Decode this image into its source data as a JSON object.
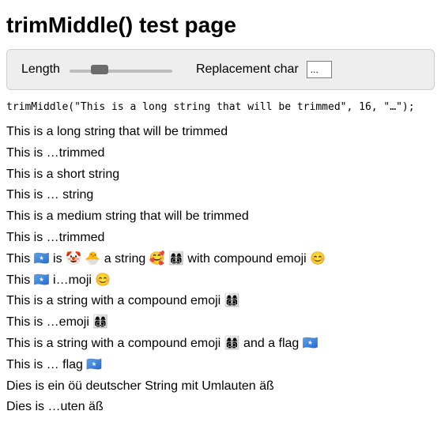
{
  "title": "trimMiddle() test page",
  "controls": {
    "length_label": "Length",
    "length_value": "16",
    "replacement_label": "Replacement char",
    "replacement_value": "..."
  },
  "code_sample": "trimMiddle(\"This is a long string that will be trimmed\", 16, \"…\");",
  "lines": [
    "This is a long string that will be trimmed",
    "This is …trimmed",
    "This is a short string",
    "This is … string",
    "This is a medium string that will be trimmed",
    "This is …trimmed",
    "This 🇸🇴 is 🤡 🐣 a string 🥰 👩‍👩‍👦‍👦 with compound emoji 😊",
    "This 🇸🇴 i…moji 😊",
    "This is a string with a compound emoji 👩‍👩‍👦‍👦",
    "This is …emoji 👩‍👩‍👦‍👦",
    "This is a string with a compound emoji 👩‍👩‍👦‍👦 and a flag 🇸🇴",
    "This is … flag 🇸🇴",
    "Dies is ein öü deutscher String mit Umlauten äß",
    "Dies is …uten äß"
  ]
}
